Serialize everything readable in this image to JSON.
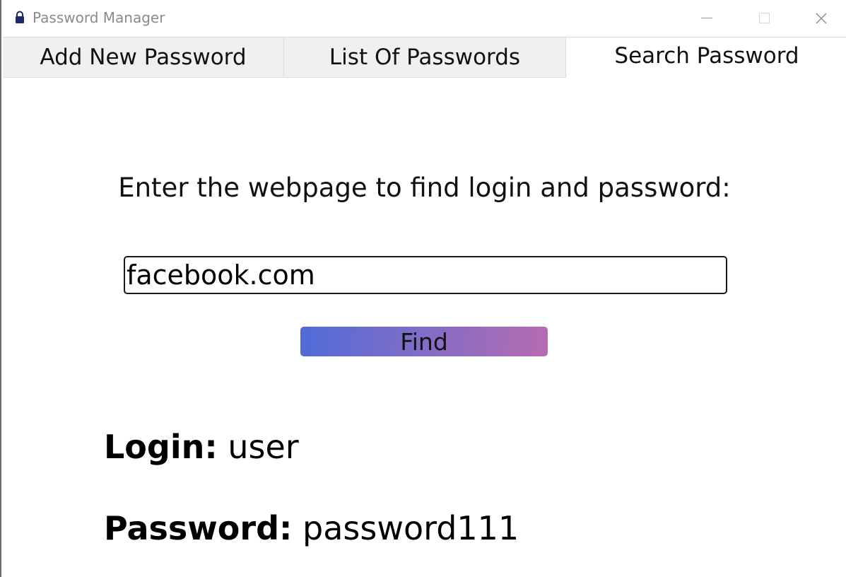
{
  "window": {
    "title": "Password Manager",
    "icon": "lock-icon",
    "controls": [
      "minimize-icon",
      "maximize-icon",
      "close-icon"
    ]
  },
  "tabs": [
    {
      "label": "Add New Password",
      "active": false
    },
    {
      "label": "List Of Passwords",
      "active": false
    },
    {
      "label": "Search Password",
      "active": true
    }
  ],
  "search": {
    "prompt": "Enter the webpage to find login and password:",
    "value": "facebook.com",
    "button_label": "Find"
  },
  "result": {
    "login_label": "Login:",
    "login_value": "user",
    "password_label": "Password:",
    "password_value": "password111"
  },
  "colors": {
    "accent_start": "#4f6bd8",
    "accent_end": "#b86bb0",
    "lock_icon": "#1b2a6b"
  }
}
